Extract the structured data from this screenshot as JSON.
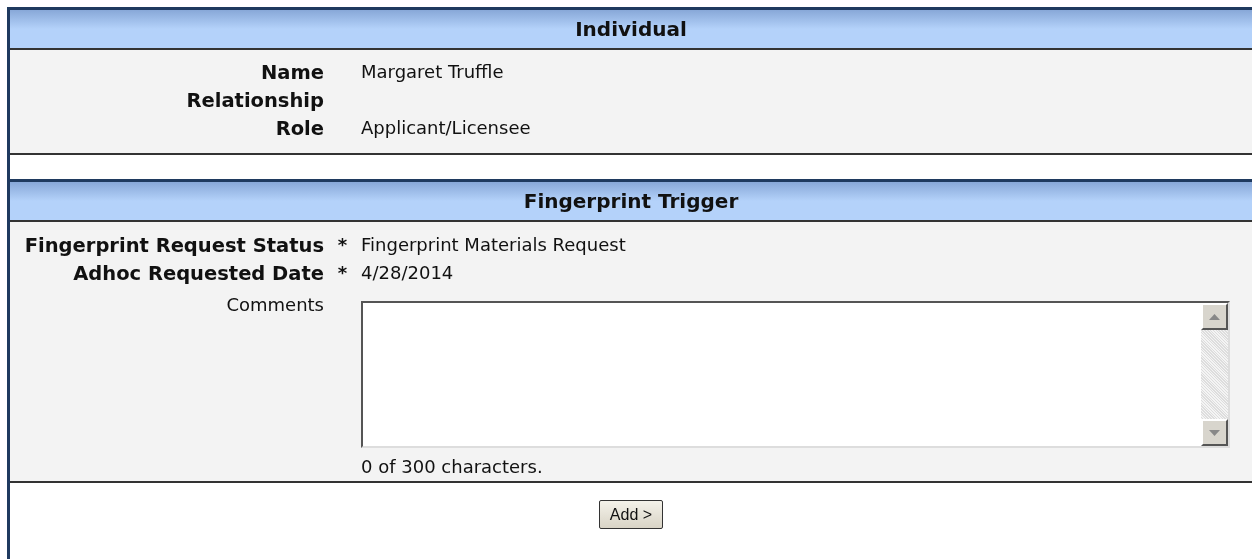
{
  "sections": [
    {
      "title": "Individual",
      "fields": [
        {
          "kind": "text",
          "label": "Name",
          "required": false,
          "value": "Margaret Truffle"
        },
        {
          "kind": "text",
          "label": "Relationship",
          "required": false
        },
        {
          "kind": "text",
          "label": "Role",
          "required": false,
          "value": "Applicant/Licensee"
        }
      ]
    },
    {
      "title": "Fingerprint Trigger",
      "fields": [
        {
          "kind": "text",
          "label": "Fingerprint Request Status",
          "required": true,
          "value": "Fingerprint Materials Request"
        },
        {
          "kind": "text",
          "label": "Adhoc Requested Date",
          "required": true,
          "value": "4/28/2014"
        },
        {
          "kind": "textarea",
          "label": "Comments",
          "required": false,
          "counter": "0 of 300 characters."
        }
      ]
    }
  ],
  "required_mark": "*",
  "button": {
    "label": "Add >"
  }
}
